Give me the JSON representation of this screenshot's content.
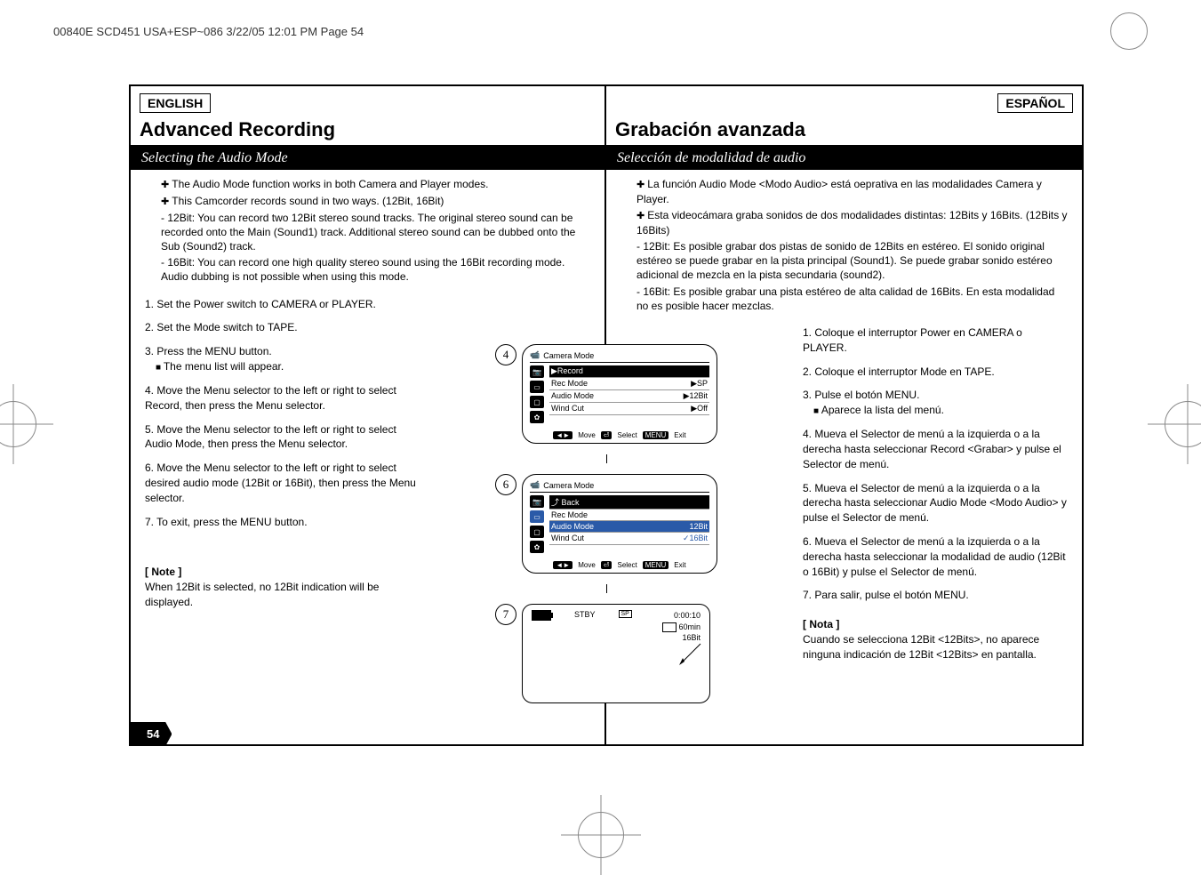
{
  "header": {
    "job_info": "00840E SCD451 USA+ESP~086  3/22/05 12:01 PM  Page 54"
  },
  "left": {
    "lang": "ENGLISH",
    "title": "Advanced Recording",
    "subtitle": "Selecting the Audio Mode",
    "intro": {
      "p1": "The Audio Mode function works in both Camera and Player modes.",
      "p2": "This Camcorder records sound in two ways. (12Bit, 16Bit)",
      "d1": "12Bit: You can record two 12Bit stereo sound tracks. The original stereo sound can be recorded onto the Main (Sound1) track. Additional stereo sound can be dubbed onto the Sub (Sound2) track.",
      "d2": "16Bit: You can record one high quality stereo sound using the 16Bit recording mode. Audio dubbing is not possible when using this mode."
    },
    "steps": {
      "s1": "1. Set the Power switch to CAMERA or PLAYER.",
      "s2": "2. Set the Mode switch to TAPE.",
      "s3": "3. Press the MENU button.",
      "s3b": "The menu list will appear.",
      "s4": "4. Move the Menu selector to the left or right to select Record, then press the Menu selector.",
      "s5": "5. Move the Menu selector to the left or right to select Audio Mode, then press the Menu selector.",
      "s6": "6. Move the Menu selector to the left or right to select desired audio mode (12Bit or 16Bit), then press the Menu selector.",
      "s7": "7. To exit, press the MENU button."
    },
    "note_label": "[ Note ]",
    "note": "When 12Bit is selected, no 12Bit indication will be displayed."
  },
  "right": {
    "lang": "ESPAÑOL",
    "title": "Grabación avanzada",
    "subtitle": "Selección de modalidad de audio",
    "intro": {
      "p1": "La función Audio Mode <Modo Audio> está oeprativa en las modalidades Camera y Player.",
      "p2": "Esta videocámara graba sonidos de dos modalidades distintas: 12Bits y 16Bits. (12Bits y 16Bits)",
      "d1": "12Bit: Es posible grabar dos pistas de sonido de 12Bits en estéreo. El sonido original estéreo se puede grabar en la pista principal (Sound1). Se puede grabar sonido estéreo adicional de mezcla en la pista secundaria (sound2).",
      "d2": "16Bit: Es posible grabar una pista estéreo de alta calidad de 16Bits. En esta modalidad no es posible hacer mezclas."
    },
    "steps": {
      "s1": "1. Coloque el interruptor Power en CAMERA o PLAYER.",
      "s2": "2. Coloque el interruptor Mode en TAPE.",
      "s3": "3. Pulse el botón MENU.",
      "s3b": "Aparece la lista del menú.",
      "s4": "4. Mueva el Selector de menú a la izquierda o a la derecha hasta seleccionar Record <Grabar> y pulse el Selector de menú.",
      "s5": "5. Mueva el Selector de menú a la izquierda o a la derecha hasta seleccionar Audio Mode <Modo Audio> y pulse el Selector de menú.",
      "s6": "6. Mueva el Selector de menú a la izquierda o a la derecha hasta seleccionar la modalidad de audio (12Bit o 16Bit) y pulse el Selector de menú.",
      "s7": "7. Para salir, pulse el botón MENU."
    },
    "note_label": "[ Nota ]",
    "note": "Cuando se selecciona 12Bit <12Bits>, no aparece ninguna indicación de 12Bit <12Bits> en pantalla."
  },
  "figures": {
    "fig4_num": "4",
    "fig6_num": "6",
    "fig7_num": "7",
    "osd4": {
      "title": "Camera Mode",
      "section": "▶Record",
      "r1_l": "Rec Mode",
      "r1_r": "▶SP",
      "r2_l": "Audio Mode",
      "r2_r": "▶12Bit",
      "r3_l": "Wind Cut",
      "r3_r": "▶Off",
      "move": "Move",
      "select": "Select",
      "exit": "Exit",
      "menu_key": "MENU"
    },
    "osd6": {
      "title": "Camera Mode",
      "back": "Back",
      "r1_l": "Rec Mode",
      "r1_r": "",
      "r2_l": "Audio Mode",
      "r2_r": "12Bit",
      "r3_l": "Wind Cut",
      "r3_r": "✓16Bit",
      "move": "Move",
      "select": "Select",
      "exit": "Exit",
      "menu_key": "MENU"
    },
    "preview": {
      "stby": "STBY",
      "sp": "SP",
      "time": "0:00:10",
      "remain": "60min",
      "bits": "16Bit"
    }
  },
  "page_number": "54"
}
